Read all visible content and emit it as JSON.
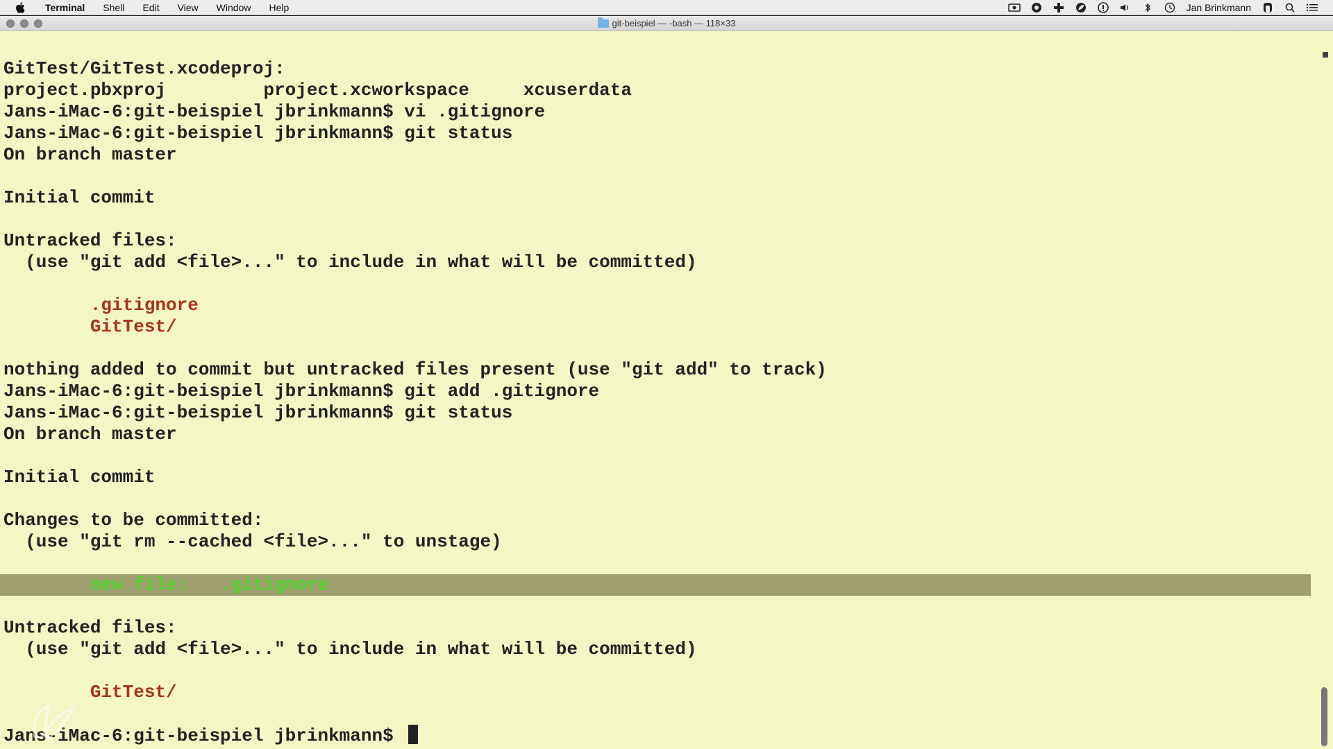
{
  "menubar": {
    "app_name": "Terminal",
    "items": [
      "Shell",
      "Edit",
      "View",
      "Window",
      "Help"
    ],
    "user_name": "Jan Brinkmann"
  },
  "window": {
    "title": "git-beispiel — -bash — 118×33"
  },
  "terminal": {
    "lines": [
      {
        "text": "GitTest/GitTest.xcodeproj:",
        "style": "normal"
      },
      {
        "text": "project.pbxproj         project.xcworkspace     xcuserdata",
        "style": "normal"
      },
      {
        "text": "Jans-iMac-6:git-beispiel jbrinkmann$ vi .gitignore",
        "style": "normal"
      },
      {
        "text": "Jans-iMac-6:git-beispiel jbrinkmann$ git status",
        "style": "normal"
      },
      {
        "text": "On branch master",
        "style": "normal"
      },
      {
        "text": "",
        "style": "normal"
      },
      {
        "text": "Initial commit",
        "style": "normal"
      },
      {
        "text": "",
        "style": "normal"
      },
      {
        "text": "Untracked files:",
        "style": "normal"
      },
      {
        "text": "  (use \"git add <file>...\" to include in what will be committed)",
        "style": "normal"
      },
      {
        "text": "",
        "style": "normal"
      },
      {
        "text": "        .gitignore",
        "style": "red"
      },
      {
        "text": "        GitTest/",
        "style": "red"
      },
      {
        "text": "",
        "style": "normal"
      },
      {
        "text": "nothing added to commit but untracked files present (use \"git add\" to track)",
        "style": "normal"
      },
      {
        "text": "Jans-iMac-6:git-beispiel jbrinkmann$ git add .gitignore",
        "style": "normal"
      },
      {
        "text": "Jans-iMac-6:git-beispiel jbrinkmann$ git status",
        "style": "normal"
      },
      {
        "text": "On branch master",
        "style": "normal"
      },
      {
        "text": "",
        "style": "normal"
      },
      {
        "text": "Initial commit",
        "style": "normal"
      },
      {
        "text": "",
        "style": "normal"
      },
      {
        "text": "Changes to be committed:",
        "style": "normal"
      },
      {
        "text": "  (use \"git rm --cached <file>...\" to unstage)",
        "style": "normal"
      },
      {
        "text": "",
        "style": "normal"
      },
      {
        "text": "        new file:   .gitignore",
        "style": "green-highlight"
      },
      {
        "text": "",
        "style": "normal"
      },
      {
        "text": "Untracked files:",
        "style": "normal"
      },
      {
        "text": "  (use \"git add <file>...\" to include in what will be committed)",
        "style": "normal"
      },
      {
        "text": "",
        "style": "normal"
      },
      {
        "text": "        GitTest/",
        "style": "red"
      },
      {
        "text": "",
        "style": "normal"
      },
      {
        "text": "Jans-iMac-6:git-beispiel jbrinkmann$ ",
        "style": "prompt"
      }
    ]
  },
  "colors": {
    "background": "#f4f7c4",
    "text": "#222222",
    "untracked": "#a8321b",
    "staged": "#4cd627",
    "highlight": "#9e9e6e"
  },
  "icons": {
    "apple": "apple-icon",
    "status": [
      "screen-record-icon",
      "app-icon",
      "plus-icon",
      "leaf-icon",
      "info-icon",
      "volume-icon",
      "bluetooth-icon",
      "time-machine-icon"
    ],
    "right": [
      "user-icon",
      "search-icon",
      "list-icon"
    ]
  }
}
